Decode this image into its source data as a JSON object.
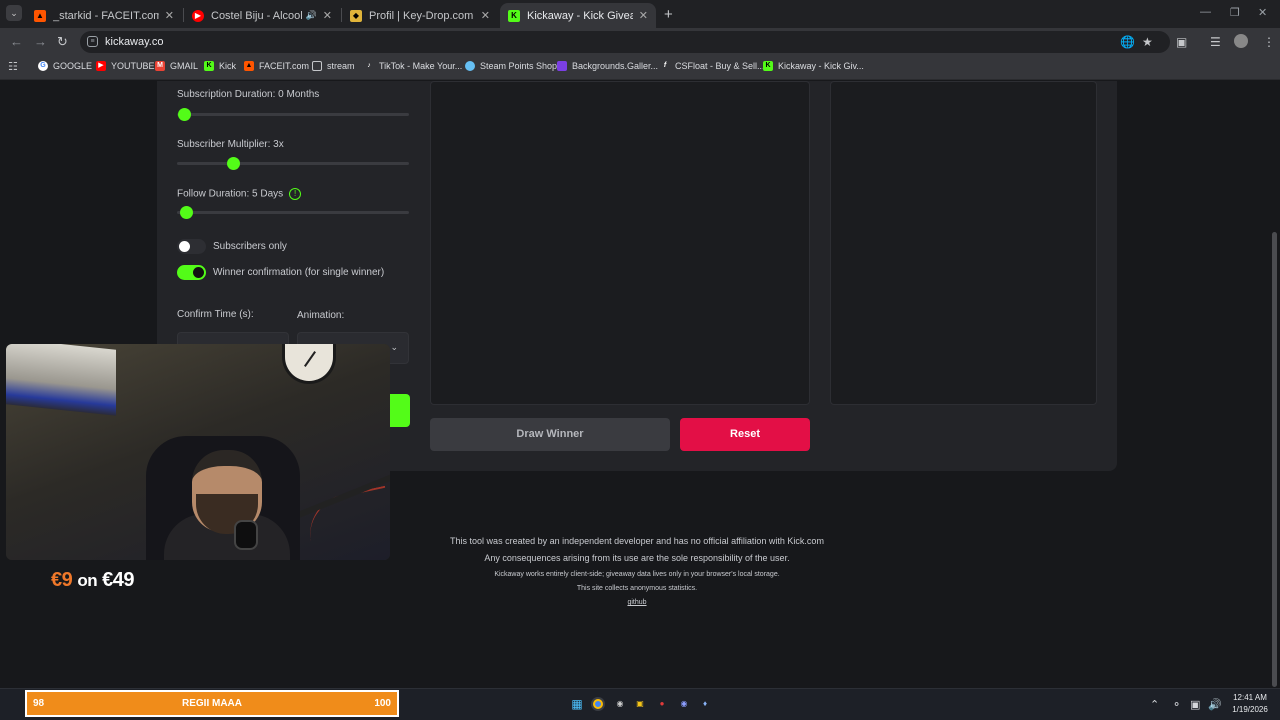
{
  "browser": {
    "tabs": [
      {
        "title": "_starkid - FACEIT.com",
        "favicon": "faceit",
        "color": "#ff5500",
        "active": false
      },
      {
        "title": "Costel Biju - Alcool si Narcotice",
        "favicon": "youtube",
        "color": "#ff0000",
        "active": false,
        "playing_audio": true
      },
      {
        "title": "Profil | Key-Drop.com",
        "favicon": "keydrop",
        "color": "#e0b43a",
        "active": false
      },
      {
        "title": "Kickaway - Kick Giveaway Tool",
        "favicon": "kickaway",
        "color": "#53fc18",
        "active": true
      }
    ],
    "url": "kickaway.co",
    "bookmarks": [
      {
        "label": "GOOGLE",
        "icon": "google-icon",
        "color": "#4285f4"
      },
      {
        "label": "YOUTUBE",
        "icon": "youtube-icon",
        "color": "#ff0000"
      },
      {
        "label": "GMAIL",
        "icon": "gmail-icon",
        "color": "#ea4335"
      },
      {
        "label": "Kick",
        "icon": "kick-icon",
        "color": "#53fc18"
      },
      {
        "label": "FACEIT.com",
        "icon": "faceit-icon",
        "color": "#ff5500"
      },
      {
        "label": "stream",
        "icon": "folder-icon",
        "color": "#9aa0a6"
      },
      {
        "label": "TikTok - Make Your...",
        "icon": "tiktok-icon",
        "color": "#ffffff"
      },
      {
        "label": "Steam Points Shop",
        "icon": "steam-icon",
        "color": "#66c0f4"
      },
      {
        "label": "Backgrounds.Galler...",
        "icon": "backgrounds-icon",
        "color": "#7b3fe4"
      },
      {
        "label": "CSFloat - Buy & Sell...",
        "icon": "csfloat-icon",
        "color": "#ffffff"
      },
      {
        "label": "Kickaway - Kick Giv...",
        "icon": "kickaway-icon",
        "color": "#53fc18"
      }
    ]
  },
  "settings": {
    "subscription_duration_label": "Subscription Duration: 0 Months",
    "subscription_duration_level": 0.03,
    "subscriber_multiplier_label": "Subscriber Multiplier: 3x",
    "subscriber_multiplier_level": 0.24,
    "follow_duration_label": "Follow Duration: 5 Days",
    "follow_duration_level": 0.04,
    "subscribers_only_label": "Subscribers only",
    "subscribers_only_enabled": false,
    "winner_confirmation_label": "Winner confirmation (for single winner)",
    "winner_confirmation_enabled": true,
    "confirm_time_label": "Confirm Time (s):",
    "animation_label": "Animation:"
  },
  "actions": {
    "draw_winner": "Draw Winner",
    "reset": "Reset"
  },
  "footer": {
    "line1": "This tool was created by an independent developer and has no official affiliation with Kick.com",
    "line2": "Any consequences arising from its use are the sole responsibility of the user.",
    "line3": "Kickaway works entirely client-side; giveaway data lives only in your browser's local storage.",
    "line4": "This site collects anonymous statistics.",
    "github": "github"
  },
  "overlay": {
    "promo_amount": "€9",
    "promo_on": "on",
    "promo_total": "€49",
    "goal_current": "98",
    "goal_title": "REGII MAAA",
    "goal_max": "100"
  },
  "taskbar": {
    "time": "12:41 AM",
    "date": "1/19/2026"
  },
  "colors": {
    "accent": "#53fc18",
    "danger": "#e30f46",
    "promo": "#f0782a",
    "goal": "#f08c1a"
  }
}
